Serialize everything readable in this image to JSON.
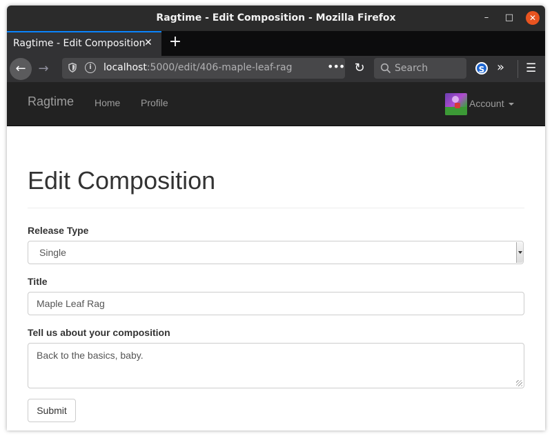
{
  "window": {
    "title": "Ragtime - Edit Composition - Mozilla Firefox",
    "minimize_glyph": "–",
    "maximize_glyph": "□",
    "close_glyph": "✕"
  },
  "browser": {
    "tab_label": "Ragtime - Edit Composition",
    "tab_close_glyph": "✕",
    "new_tab_glyph": "+",
    "url_host": "localhost",
    "url_rest": ":5000/edit/406-maple-leaf-rag",
    "url_more_glyph": "•••",
    "search_placeholder": "Search",
    "extension_letter": "S",
    "overflow_glyph": "»",
    "menu_glyph": "☰",
    "back_glyph": "←",
    "forward_glyph": "→",
    "reload_glyph": "↻",
    "accent_color": "#0a84ff"
  },
  "site_nav": {
    "brand": "Ragtime",
    "links": [
      "Home",
      "Profile"
    ],
    "account_label": "Account"
  },
  "page": {
    "title": "Edit Composition",
    "release_type_label": "Release Type",
    "release_type_value": "Single",
    "title_label": "Title",
    "title_value": "Maple Leaf Rag",
    "about_label": "Tell us about your composition",
    "about_value": "Back to the basics, baby.",
    "submit_label": "Submit"
  }
}
